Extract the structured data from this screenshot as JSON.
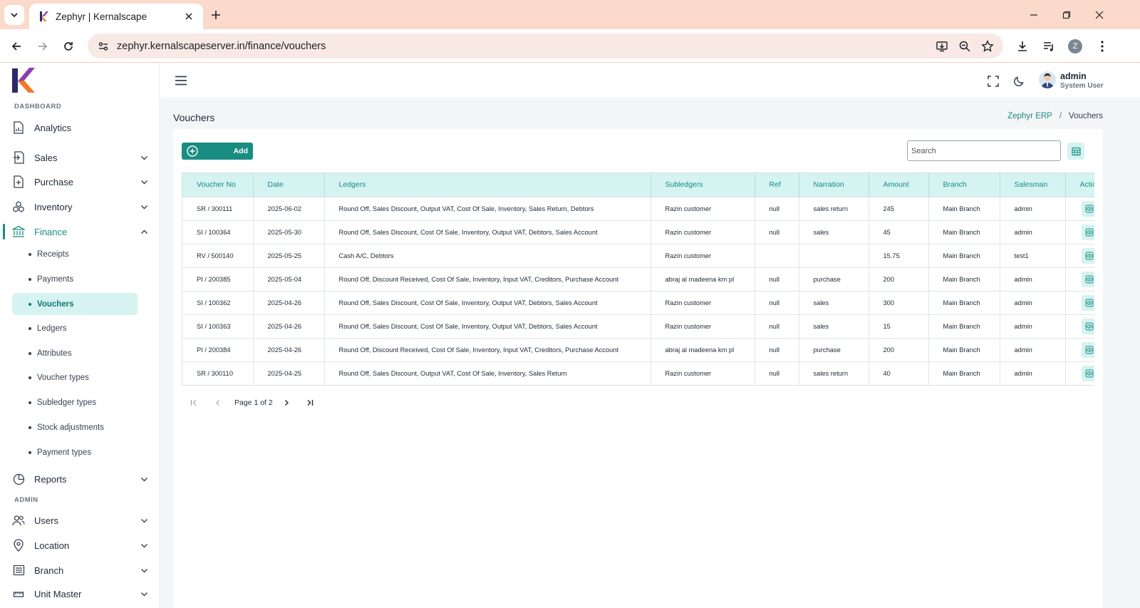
{
  "browser": {
    "tab_title": "Zephyr | Kernalscape",
    "url": "zephyr.kernalscapeserver.in/finance/vouchers",
    "profile_initial": "Z"
  },
  "sidebar": {
    "section_dashboard": "DASHBOARD",
    "section_admin": "ADMIN",
    "items": {
      "analytics": "Analytics",
      "sales": "Sales",
      "purchase": "Purchase",
      "inventory": "Inventory",
      "finance": "Finance",
      "reports": "Reports",
      "users": "Users",
      "location": "Location",
      "branch": "Branch",
      "unit_master": "Unit Master"
    },
    "finance_sub": [
      "Receipts",
      "Payments",
      "Vouchers",
      "Ledgers",
      "Attributes",
      "Voucher types",
      "Subledger types",
      "Stock adjustments",
      "Payment types"
    ]
  },
  "header": {
    "user_name": "admin",
    "user_role": "System User"
  },
  "page": {
    "title": "Vouchers",
    "breadcrumb_root": "Zephyr ERP",
    "breadcrumb_sep": "/",
    "breadcrumb_current": "Vouchers",
    "add_label": "Add",
    "search_placeholder": "Search"
  },
  "table": {
    "columns": [
      "Voucher No",
      "Date",
      "Ledgers",
      "Subledgers",
      "Ref",
      "Narration",
      "Amount",
      "Branch",
      "Salesman",
      "Actions"
    ],
    "rows": [
      [
        "SR / 300111",
        "2025-06-02",
        "Round Off, Sales Discount, Output VAT, Cost Of Sale, Inventory, Sales Return, Debtors",
        "Razin customer",
        "null",
        "sales return",
        "245",
        "Main Branch",
        "admin"
      ],
      [
        "SI / 100364",
        "2025-05-30",
        "Round Off, Sales Discount, Cost Of Sale, Inventory, Output VAT, Debtors, Sales Account",
        "Razin customer",
        "null",
        "sales",
        "45",
        "Main Branch",
        "admin"
      ],
      [
        "RV / 500140",
        "2025-05-25",
        "Cash A/C, Debtors",
        "Razin customer",
        "",
        "",
        "15.75",
        "Main Branch",
        "test1"
      ],
      [
        "PI / 200385",
        "2025-05-04",
        "Round Off, Discount Received, Cost Of Sale, Inventory, Input VAT, Creditors, Purchase Account",
        "abraj al madeena km pl",
        "null",
        "purchase",
        "200",
        "Main Branch",
        "admin"
      ],
      [
        "SI / 100362",
        "2025-04-26",
        "Round Off, Sales Discount, Cost Of Sale, Inventory, Output VAT, Debtors, Sales Account",
        "Razin customer",
        "null",
        "sales",
        "300",
        "Main Branch",
        "admin"
      ],
      [
        "SI / 100363",
        "2025-04-26",
        "Round Off, Sales Discount, Cost Of Sale, Inventory, Output VAT, Debtors, Sales Account",
        "Razin customer",
        "null",
        "sales",
        "15",
        "Main Branch",
        "admin"
      ],
      [
        "PI / 200384",
        "2025-04-26",
        "Round Off, Discount Received, Cost Of Sale, Inventory, Input VAT, Creditors, Purchase Account",
        "abraj al madeena km pl",
        "null",
        "purchase",
        "200",
        "Main Branch",
        "admin"
      ],
      [
        "SR / 300110",
        "2025-04-25",
        "Round Off, Sales Discount, Output VAT, Cost Of Sale, Inventory, Sales Return",
        "Razin customer",
        "null",
        "sales return",
        "40",
        "Main Branch",
        "admin"
      ]
    ]
  },
  "pagination": {
    "label": "Page 1 of 2"
  },
  "colors": {
    "accent": "#1a8d82",
    "accent_light": "#d4f3f1",
    "browser_frame": "#fbd9cb"
  }
}
